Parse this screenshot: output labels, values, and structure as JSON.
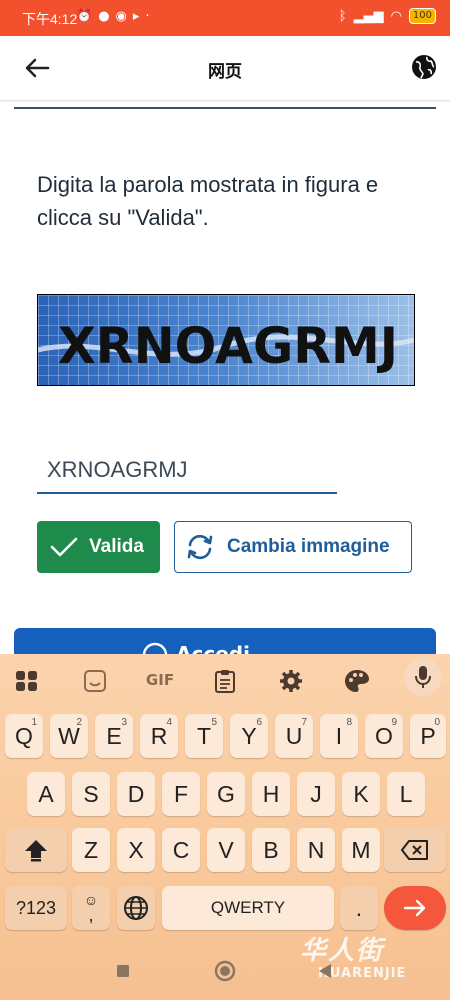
{
  "status_bar": {
    "time": "下午4:12",
    "battery": "100"
  },
  "header": {
    "title": "网页"
  },
  "main": {
    "instructions": "Digita la parola mostrata in figura e clicca su \"Valida\".",
    "captcha_text": "XRNOAGRMJ",
    "input_value": "XRNOAGRMJ",
    "valida_label": "Valida",
    "cambia_label": "Cambia immagine",
    "partial_button_label": "Accedi"
  },
  "keyboard": {
    "row1": [
      [
        "Q",
        "1"
      ],
      [
        "W",
        "2"
      ],
      [
        "E",
        "3"
      ],
      [
        "R",
        "4"
      ],
      [
        "T",
        "5"
      ],
      [
        "Y",
        "6"
      ],
      [
        "U",
        "7"
      ],
      [
        "I",
        "8"
      ],
      [
        "O",
        "9"
      ],
      [
        "P",
        "0"
      ]
    ],
    "row2": [
      "A",
      "S",
      "D",
      "F",
      "G",
      "H",
      "J",
      "K",
      "L"
    ],
    "row3": [
      "Z",
      "X",
      "C",
      "V",
      "B",
      "N",
      "M"
    ],
    "symbols_label": "?123",
    "space_label": "QWERTY",
    "period_label": ".",
    "comma_label": ",",
    "gif_label": "GIF"
  },
  "watermark": {
    "text": "华人街",
    "sub": "HUARENJIE"
  },
  "colors": {
    "status_bar": "#f3502e",
    "accent_blue": "#1f5e99",
    "valida_green": "#1e8a4c",
    "enter_key": "#f4573b"
  }
}
